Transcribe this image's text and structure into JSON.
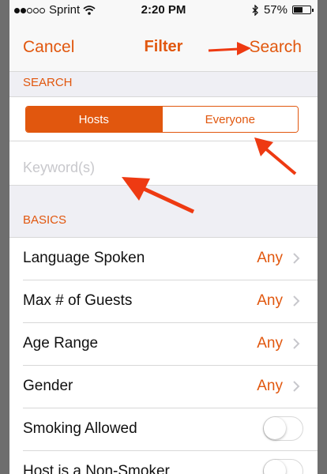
{
  "status_bar": {
    "carrier": "Sprint",
    "time": "2:20 PM",
    "battery": "57%",
    "signal_bars": 2,
    "signal_total": 5
  },
  "navbar": {
    "cancel_label": "Cancel",
    "title": "Filter",
    "search_label": "Search"
  },
  "search_section": {
    "header": "SEARCH",
    "segments": [
      "Hosts",
      "Everyone"
    ],
    "selected_segment": "Hosts",
    "keyword_placeholder": "Keyword(s)",
    "keyword_value": ""
  },
  "basics_section": {
    "header": "BASICS",
    "rows": [
      {
        "label": "Language Spoken",
        "value": "Any"
      },
      {
        "label": "Max # of Guests",
        "value": "Any"
      },
      {
        "label": "Age Range",
        "value": "Any"
      },
      {
        "label": "Gender",
        "value": "Any"
      }
    ],
    "toggles": [
      {
        "label": "Smoking Allowed",
        "on": false
      },
      {
        "label": "Host is a Non-Smoker",
        "on": false
      }
    ]
  },
  "colors": {
    "accent": "#e1570e",
    "annotation_arrow": "#ee3a12"
  },
  "icons": [
    "wifi-icon",
    "bluetooth-icon",
    "battery-icon",
    "chevron-right-icon"
  ]
}
